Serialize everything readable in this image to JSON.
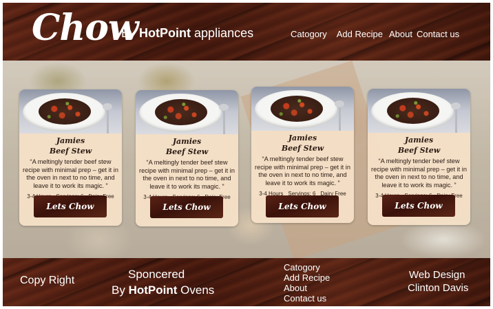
{
  "header": {
    "logo": "Chow",
    "byline_prefix": "By",
    "byline_brand": "HotPoint",
    "byline_suffix": "appliances",
    "nav": [
      "Catogory",
      "Add Recipe",
      "About",
      "Contact us"
    ]
  },
  "cards": [
    {
      "title_line1": "Jamies",
      "title_line2": "Beef Stew",
      "description": "“A meltingly tender beef stew recipe with minimal prep – get it in the oven in next to no time, and leave it to work its magic. ”",
      "time": "3-4 Hours",
      "servings": "Servings: 6",
      "diet": "Dairy Free",
      "button": "Lets Chow"
    },
    {
      "title_line1": "Jamies",
      "title_line2": "Beef Stew",
      "description": "“A meltingly tender beef stew recipe with minimal prep – get it in the oven in next to no time, and leave it to work its magic. ”",
      "time": "3-4 Hours",
      "servings": "Servings: 6",
      "diet": "Dairy Free",
      "button": "Lets Chow"
    },
    {
      "title_line1": "Jamies",
      "title_line2": "Beef Stew",
      "description": "“A meltingly tender beef stew recipe with minimal prep – get it in the oven in next to no time, and leave it to work its magic. ”",
      "time": "3-4 Hours",
      "servings": "Servings: 6",
      "diet": "Dairy Free",
      "button": "Lets Chow"
    },
    {
      "title_line1": "Jamies",
      "title_line2": "Beef Stew",
      "description": "“A meltingly tender beef stew recipe with minimal prep – get it in the oven in next to no time, and leave it to work its magic. ”",
      "time": "3-4 Hours",
      "servings": "Servings: 6",
      "diet": "Dairy Free",
      "button": "Lets Chow"
    }
  ],
  "footer": {
    "copyright": "Copy Right",
    "sponsored_line1": "Sponcered",
    "sponsored_prefix": "By",
    "sponsored_brand": "HotPoint",
    "sponsored_suffix": "Ovens",
    "links": [
      "Catogory",
      "Add Recipe",
      "About",
      "Contact us"
    ],
    "credit_line1": "Web Design",
    "credit_line2": "Clinton Davis"
  },
  "colors": {
    "wood_dark": "#3e160d",
    "card_bg": "#f6e1c8",
    "button_bg": "#4a1a10",
    "text_light": "#ffffff"
  }
}
